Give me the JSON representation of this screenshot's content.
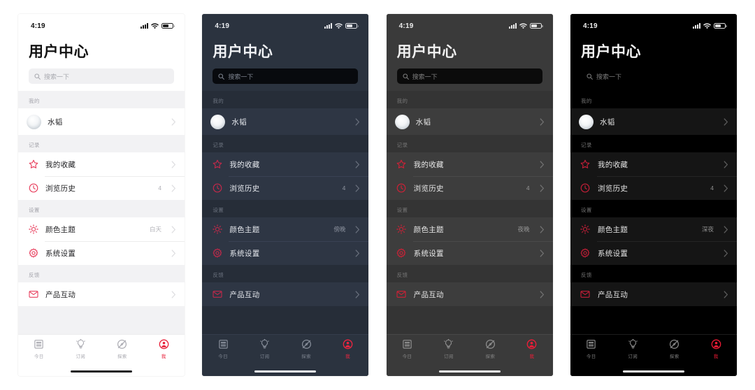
{
  "status_bar": {
    "time": "4:19",
    "signal_icon": "cellular-signal-icon",
    "wifi_icon": "wifi-icon",
    "battery_icon": "battery-icon"
  },
  "header": {
    "title": "用户中心",
    "search_placeholder": "搜索一下",
    "search_icon": "search-icon"
  },
  "sections": [
    {
      "label": "我的"
    },
    {
      "label": "记录"
    },
    {
      "label": "设置"
    },
    {
      "label": "反馈"
    }
  ],
  "rows": {
    "user": {
      "name": "水韬",
      "avatar": "user-avatar"
    },
    "favorites": {
      "label": "我的收藏",
      "icon": "star-icon",
      "value": ""
    },
    "history": {
      "label": "浏览历史",
      "icon": "clock-icon",
      "value": "4"
    },
    "theme": {
      "label": "颜色主题",
      "icon": "brightness-icon"
    },
    "system": {
      "label": "系统设置",
      "icon": "gear-icon",
      "value": ""
    },
    "feedback": {
      "label": "产品互动",
      "icon": "envelope-icon",
      "value": ""
    }
  },
  "tabs": [
    {
      "label": "今日",
      "icon": "newspaper-icon",
      "active": false
    },
    {
      "label": "订阅",
      "icon": "lightbulb-icon",
      "active": false
    },
    {
      "label": "探索",
      "icon": "compass-icon",
      "active": false
    },
    {
      "label": "我",
      "icon": "person-icon",
      "active": true
    }
  ],
  "panels": [
    {
      "id": "day",
      "theme_name": "白天",
      "accent": "#e8415f",
      "bg": "#ffffff"
    },
    {
      "id": "dusk",
      "theme_name": "傍晚",
      "accent": "#c2294a",
      "bg": "#2b333f"
    },
    {
      "id": "night",
      "theme_name": "夜晚",
      "accent": "#cf2036",
      "bg": "#3a3a3a"
    },
    {
      "id": "midnight",
      "theme_name": "深夜",
      "accent": "#c41f38",
      "bg": "#000000"
    }
  ]
}
